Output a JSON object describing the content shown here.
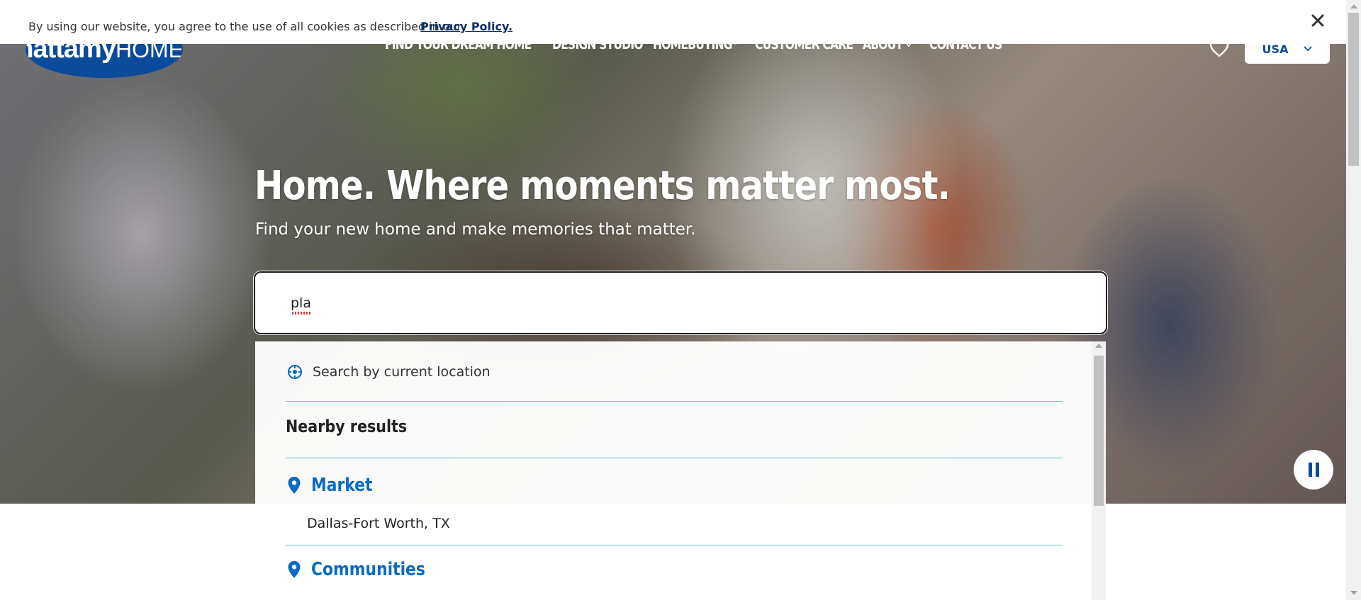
{
  "cookie_banner": {
    "message": "By using our website, you agree to the use of all cookies as described in our",
    "link_label": "Privacy Policy.",
    "close_icon": "close-icon"
  },
  "header": {
    "logo_text_main": "mattamy",
    "logo_text_sub": "HOMES",
    "nav": [
      {
        "label": "FIND YOUR DREAM HOME",
        "has_dropdown": true
      },
      {
        "label": "DESIGN STUDIO",
        "has_dropdown": false
      },
      {
        "label": "HOMEBUYING",
        "has_dropdown": true
      },
      {
        "label": "CUSTOMER CARE",
        "has_dropdown": false
      },
      {
        "label": "ABOUT",
        "has_dropdown": true
      },
      {
        "label": "CONTACT US",
        "has_dropdown": false
      }
    ],
    "favorites_icon": "heart-icon",
    "region_selected": "USA"
  },
  "hero": {
    "title": "Home. Where moments matter most.",
    "subtitle": "Find your new home and make memories that matter."
  },
  "search": {
    "value": "pla"
  },
  "dropdown": {
    "current_location_label": "Search by current location",
    "section_heading": "Nearby results",
    "categories": [
      {
        "label": "Market",
        "items": [
          "Dallas-Fort Worth, TX"
        ]
      },
      {
        "label": "Communities",
        "items": []
      }
    ]
  },
  "colors": {
    "brand_blue": "#0b4a9c",
    "link_blue": "#0b6ac4",
    "divider_teal": "#5fc1c8"
  }
}
